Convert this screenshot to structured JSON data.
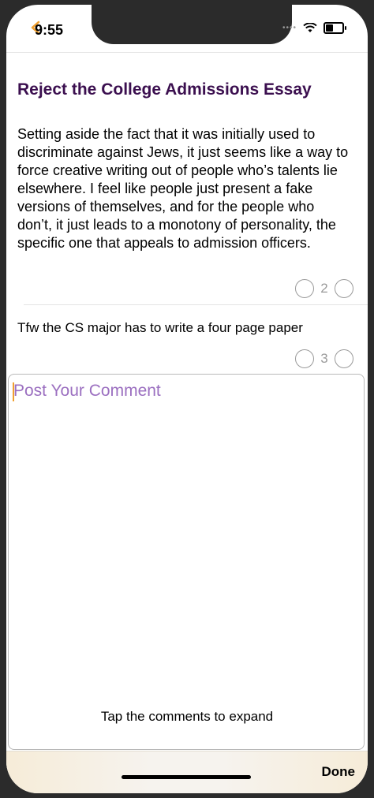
{
  "status_bar": {
    "time": "9:55",
    "signal": "••••"
  },
  "post": {
    "title": "Reject the College Admissions Essay",
    "body": "Setting aside the fact that it was initially used to discriminate against Jews, it just seems like a way to force creative writing out of people who’s talents lie elsewhere. I feel like people just present a fake versions of themselves, and for the people who don’t, it just leads to a monotony of personality, the specific one that appeals to admission officers.",
    "votes": "2"
  },
  "comments": [
    {
      "text": "Tfw the CS major has to write a four page paper",
      "votes": "3"
    }
  ],
  "comment_input": {
    "placeholder": "Post Your Comment"
  },
  "hint": "Tap the comments to expand",
  "toolbar": {
    "done_label": "Done"
  },
  "colors": {
    "title": "#3b0f4f",
    "placeholder": "#9b6fc0",
    "caret": "#f0a030"
  }
}
